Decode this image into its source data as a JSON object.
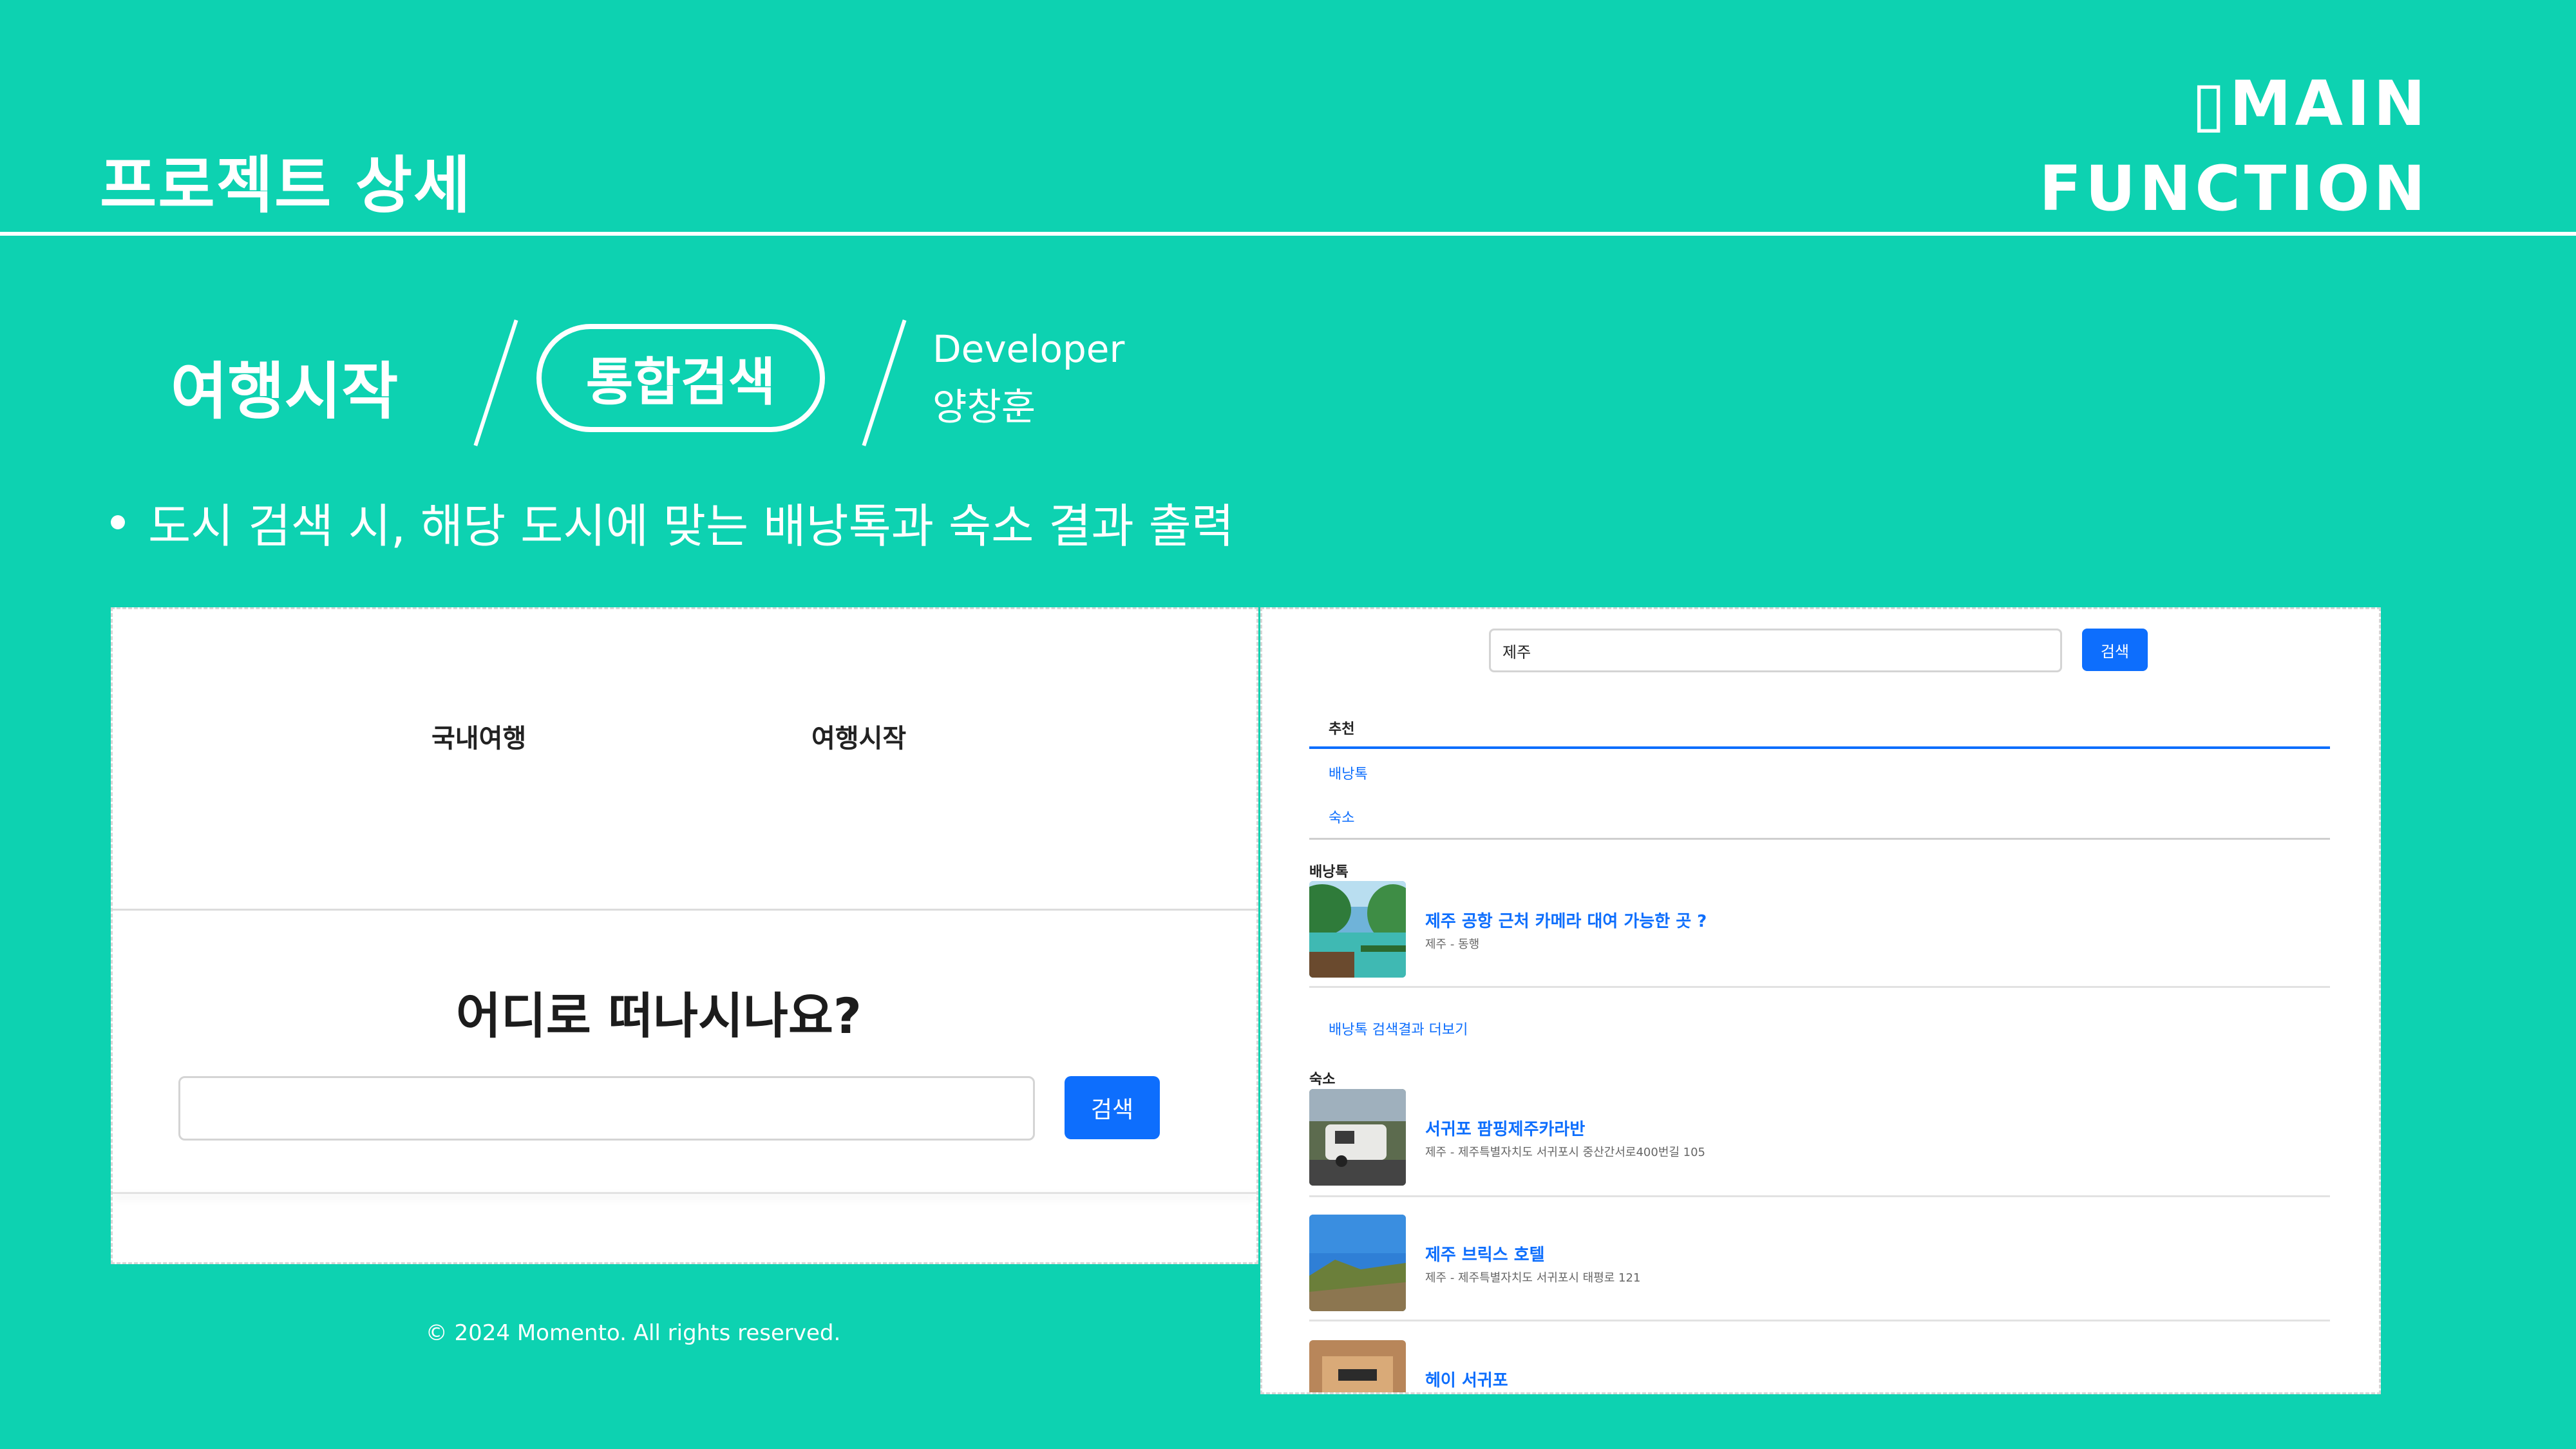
{
  "slide": {
    "title": "프로젝트 상세",
    "top_right_line1": "MAIN",
    "top_right_line2": "FUNCTION",
    "section_name": "여행시작",
    "feature_pill": "통합검색",
    "developer_role": "Developer",
    "developer_name": "양창훈",
    "bullet": "도시 검색 시, 해당 도시에 맞는 배낭톡과 숙소 결과 출력"
  },
  "left_screenshot": {
    "nav": [
      "국내여행",
      "여행시작"
    ],
    "hero_title": "어디로 떠나시나요?",
    "search_value": "",
    "search_button": "검색",
    "footer": "© 2024 Momento. All rights reserved."
  },
  "right_screenshot": {
    "search_value": "제주",
    "search_button": "검색",
    "tabs": [
      "추천",
      "배낭톡",
      "숙소"
    ],
    "backpack_heading": "배낭톡",
    "backpack_items": [
      {
        "title": "제주 공항 근처 카메라 대여 가능한 곳 ?",
        "sub": "제주 - 동행",
        "icon": "lagoon-photo"
      }
    ],
    "backpack_more": "배낭톡 검색결과 더보기",
    "lodging_heading": "숙소",
    "lodging_items": [
      {
        "title": "서귀포 팜핑제주카라반",
        "sub": "제주 - 제주특별자치도 서귀포시 중산간서로400번길 105",
        "icon": "caravan-photo"
      },
      {
        "title": "제주 브릭스 호텔",
        "sub": "제주 - 제주특별자치도 서귀포시 태평로 121",
        "icon": "coast-photo"
      },
      {
        "title": "헤이 서귀포",
        "sub": "",
        "icon": "lobby-photo"
      }
    ]
  },
  "colors": {
    "background": "#0dd2b1",
    "accent_blue": "#0d6efd"
  }
}
